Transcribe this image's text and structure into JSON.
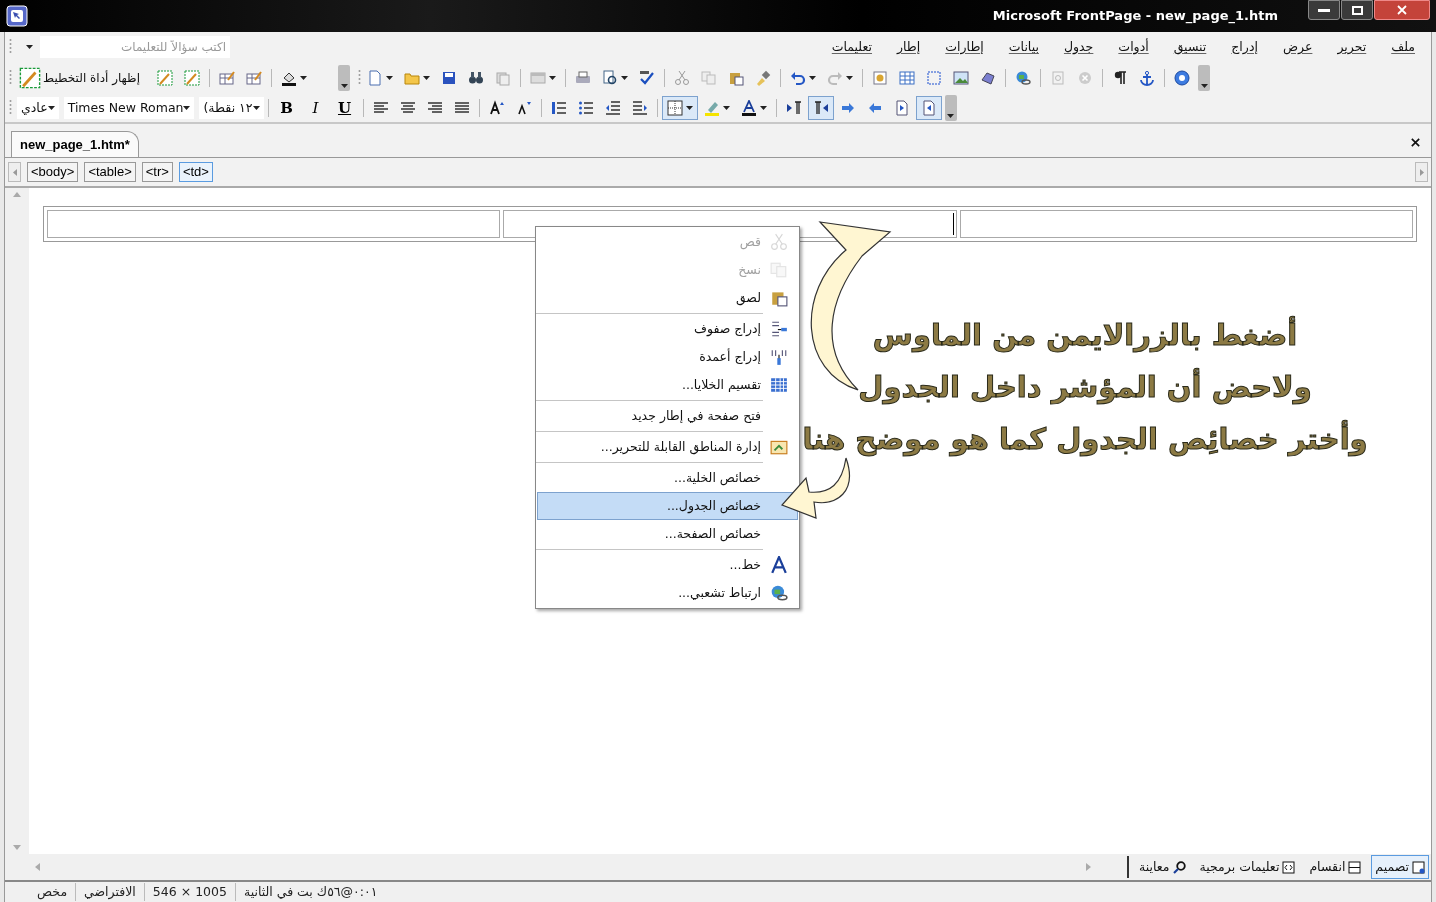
{
  "window": {
    "title": "Microsoft FrontPage - new_page_1.htm"
  },
  "menu_bar": {
    "items": [
      "ملف",
      "تحرير",
      "عرض",
      "إدراج",
      "تنسيق",
      "أدوات",
      "جدول",
      "بيانات",
      "إطارات",
      "إطار",
      "تعليمات"
    ],
    "help_search": {
      "placeholder": "اكتب سؤالاً للتعليمات"
    }
  },
  "standard_toolbar": {
    "layout_tool_button": "إظهار أداة التخطيط"
  },
  "formatting_toolbar": {
    "style": "عادي",
    "font": "Times New Roman",
    "size": "١٢ نقطة)",
    "bold": "B",
    "italic": "I",
    "underline": "U"
  },
  "document_tabs": [
    {
      "label": "new_page_1.htm*",
      "selected": true
    }
  ],
  "tag_selector": [
    {
      "label": "<td>",
      "selected": true
    },
    {
      "label": "<tr>",
      "selected": false
    },
    {
      "label": "<table>",
      "selected": false
    },
    {
      "label": "<body>",
      "selected": false
    }
  ],
  "context_menu": {
    "groups": [
      [
        {
          "label": "قص",
          "disabled": true,
          "selected": false
        },
        {
          "label": "نسخ",
          "disabled": true,
          "selected": false
        },
        {
          "label": "لصق",
          "disabled": false,
          "selected": false
        }
      ],
      [
        {
          "label": "إدراج صفوف",
          "disabled": false,
          "selected": false
        },
        {
          "label": "إدراج أعمدة",
          "disabled": false,
          "selected": false
        },
        {
          "label": "تقسيم الخلايا...",
          "disabled": false,
          "selected": false
        }
      ],
      [
        {
          "label": "فتح صفحة في إطار جديد",
          "disabled": false,
          "selected": false
        }
      ],
      [
        {
          "label": "إدارة المناطق القابلة للتحرير...",
          "disabled": false,
          "selected": false
        }
      ],
      [
        {
          "label": "خصائص الخلية...",
          "disabled": false,
          "selected": false
        },
        {
          "label": "خصائص الجدول...",
          "disabled": false,
          "selected": true
        },
        {
          "label": "خصائص الصفحة...",
          "disabled": false,
          "selected": false
        }
      ],
      [
        {
          "label": "خط...",
          "disabled": false,
          "selected": false
        },
        {
          "label": "ارتباط تشعبي...",
          "disabled": false,
          "selected": false
        }
      ]
    ]
  },
  "annotation": {
    "lines": [
      "أضغط بالزرالايمن من الماوس",
      "ولاحض أن المؤشر داخل الجدول",
      "وأختر خصائِص الجدول كما هو موضح هنا"
    ]
  },
  "view_tabs": [
    {
      "label": "تصميم",
      "selected": true
    },
    {
      "label": "انقسام",
      "selected": false
    },
    {
      "label": "تعليمات برمجية",
      "selected": false
    },
    {
      "label": "معاينة",
      "selected": false
    }
  ],
  "status_bar": [
    "٠:٠١@٥٦ك بت في الثانية",
    "1005 × 546",
    "الافتراضي",
    "مخص"
  ]
}
